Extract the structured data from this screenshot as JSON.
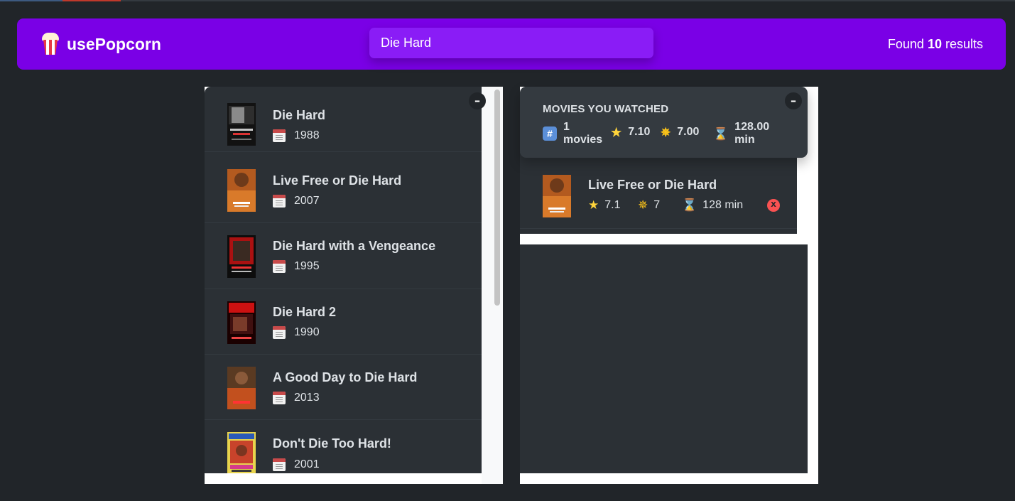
{
  "app": {
    "logo_text": "usePopcorn",
    "search_value": "Die Hard",
    "results_prefix": "Found ",
    "results_count": "10",
    "results_suffix": " results"
  },
  "colors": {
    "nav": "#7a00e6",
    "search_bg": "#8a1cf6",
    "background": "#212529",
    "box": "#2b3035",
    "summary": "#343a40",
    "delete": "#fa5252"
  },
  "list_box": {
    "toggle": "–",
    "movies": [
      {
        "title": "Die Hard",
        "year": "1988",
        "poster": "poster-die-hard"
      },
      {
        "title": "Live Free or Die Hard",
        "year": "2007",
        "poster": "poster-live-free"
      },
      {
        "title": "Die Hard with a Vengeance",
        "year": "1995",
        "poster": "poster-vengeance"
      },
      {
        "title": "Die Hard 2",
        "year": "1990",
        "poster": "poster-die-hard-2"
      },
      {
        "title": "A Good Day to Die Hard",
        "year": "2013",
        "poster": "poster-good-day"
      },
      {
        "title": "Don't Die Too Hard!",
        "year": "2001",
        "poster": "poster-dont-die"
      }
    ]
  },
  "watched_box": {
    "toggle": "–",
    "summary_title": "Movies you watched",
    "stats": {
      "count_value": "1",
      "count_unit": "movies",
      "imdb_avg": "7.10",
      "user_avg": "7.00",
      "runtime_value": "128.00",
      "runtime_unit": "min"
    },
    "movies": [
      {
        "title": "Live Free or Die Hard",
        "imdb": "7.1",
        "user": "7",
        "runtime": "128 min",
        "delete": "X"
      }
    ]
  }
}
